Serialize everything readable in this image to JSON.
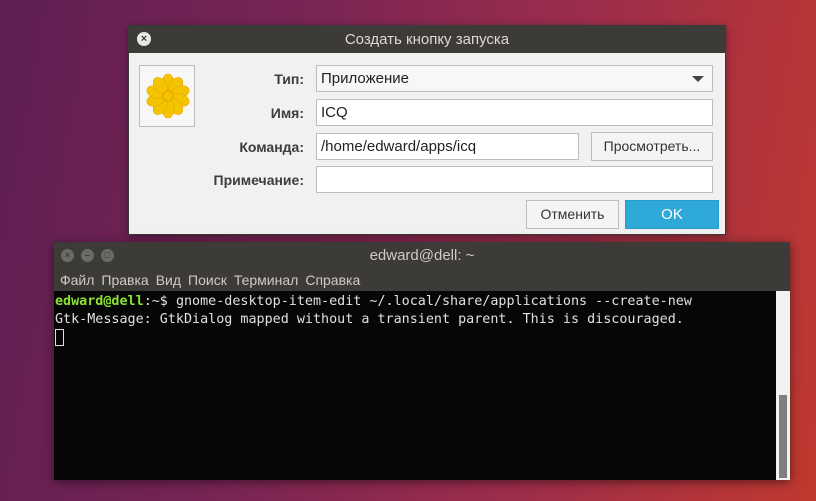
{
  "dialog": {
    "title": "Создать кнопку запуска",
    "close_icon": "×",
    "type_label": "Тип:",
    "type_value": "Приложение",
    "name_label": "Имя:",
    "name_value": "ICQ",
    "command_label": "Команда:",
    "command_value": "/home/edward/apps/icq",
    "browse_label": "Просмотреть...",
    "comment_label": "Примечание:",
    "comment_value": "",
    "cancel_label": "Отменить",
    "ok_label": "OK",
    "accent": "#2ea9d8"
  },
  "terminal": {
    "title": "edward@dell: ~",
    "menu": [
      "Файл",
      "Правка",
      "Вид",
      "Поиск",
      "Терминал",
      "Справка"
    ],
    "prompt_user": "edward@dell",
    "prompt_path": ":~$ ",
    "command": "gnome-desktop-item-edit ~/.local/share/applications --create-new",
    "output": "Gtk-Message: GtkDialog mapped without a transient parent. This is discouraged.",
    "scroll_position_percent": 55,
    "scroll_visible_percent": 45
  }
}
